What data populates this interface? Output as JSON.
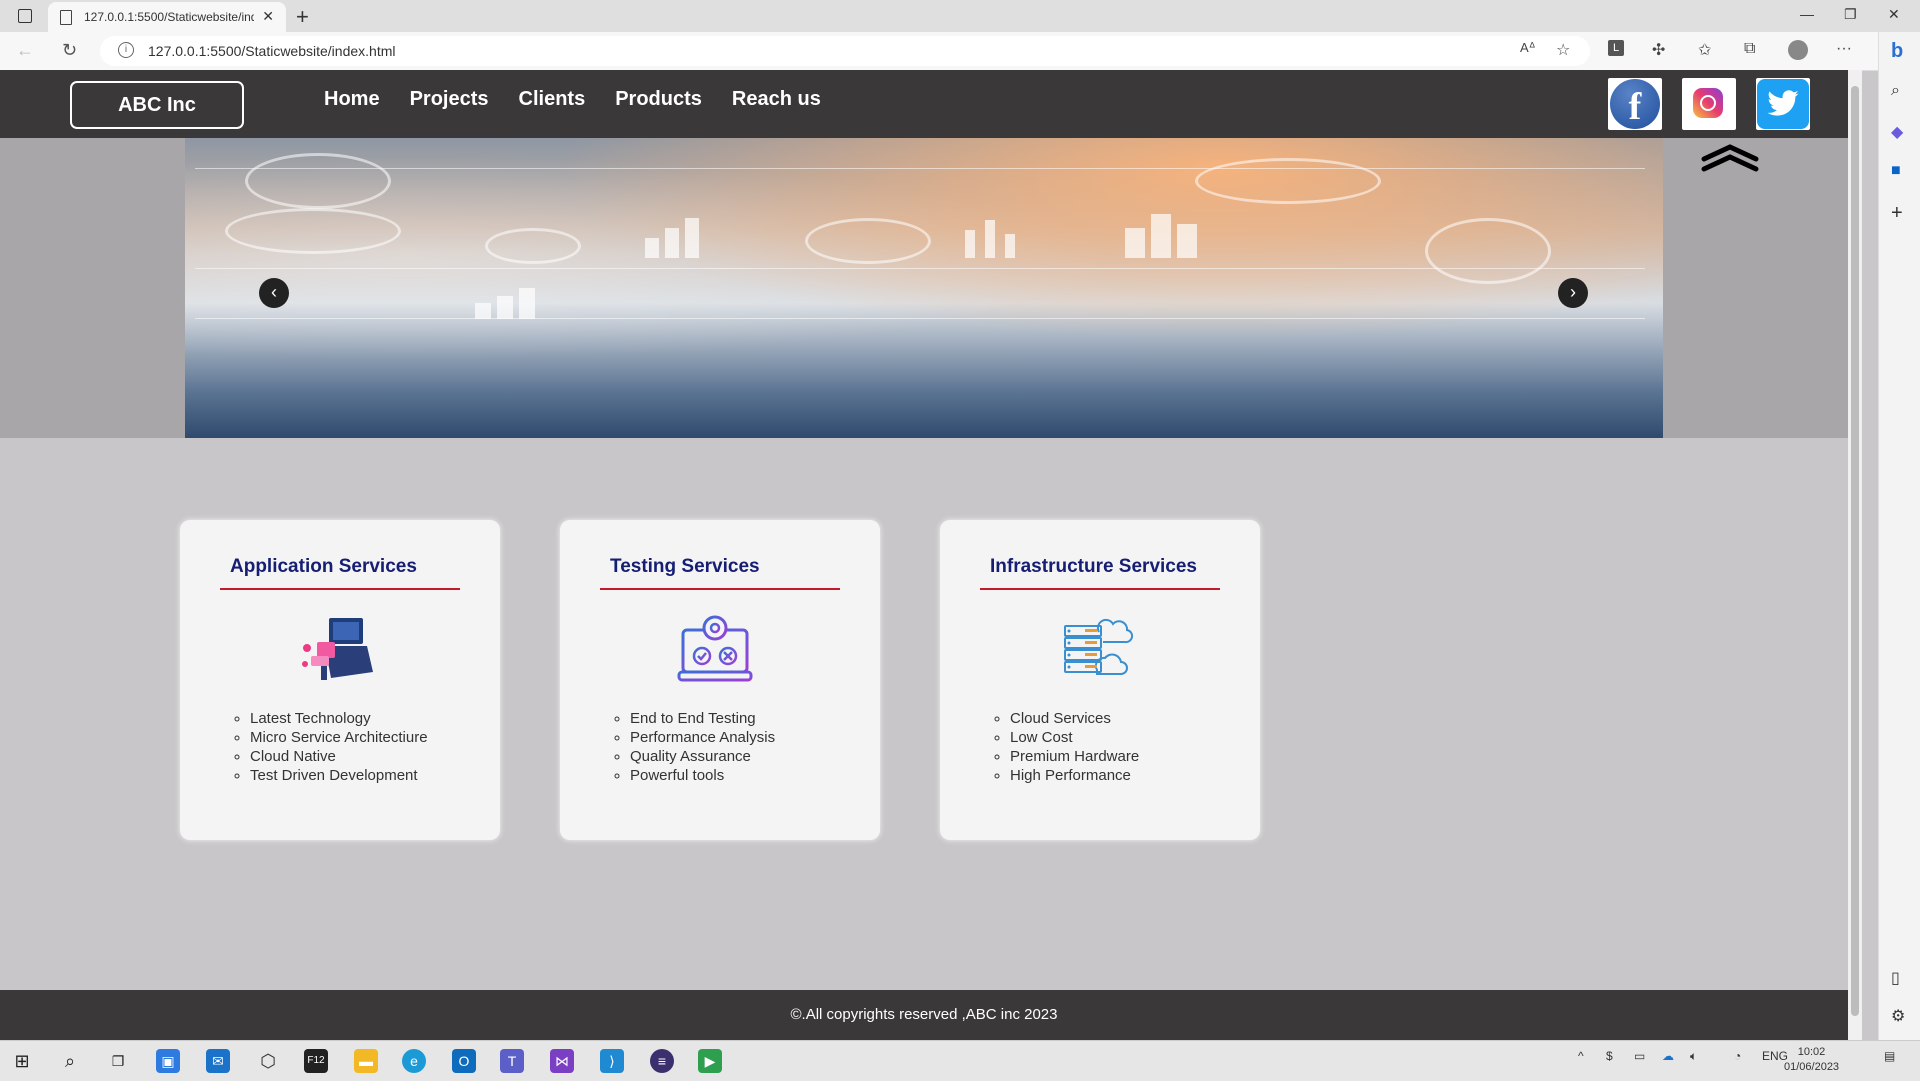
{
  "browser": {
    "tab_title": "127.0.0.1:5500/Staticwebsite/inde",
    "url": "127.0.0.1:5500/Staticwebsite/index.html"
  },
  "site": {
    "logo": "ABC Inc",
    "nav": [
      "Home",
      "Projects",
      "Clients",
      "Products",
      "Reach us"
    ],
    "social": [
      {
        "name": "facebook",
        "glyph": "f"
      },
      {
        "name": "instagram"
      },
      {
        "name": "twitter"
      }
    ],
    "carousel": {
      "prev": "‹",
      "next": "›"
    },
    "cards": [
      {
        "title": "Application Services",
        "icon": "developer-laptop-icon",
        "items": [
          "Latest Technology",
          "Micro Service Architectiure",
          "Cloud Native",
          "Test Driven Development"
        ]
      },
      {
        "title": "Testing Services",
        "icon": "testing-gear-laptop-icon",
        "items": [
          "End to End Testing",
          "Performance Analysis",
          "Quality Assurance",
          "Powerful tools"
        ]
      },
      {
        "title": "Infrastructure Services",
        "icon": "server-cloud-icon",
        "items": [
          "Cloud Services",
          "Low Cost",
          "Premium Hardware",
          "High Performance"
        ]
      }
    ],
    "footer": "©.All copyrights reserved ,ABC inc 2023"
  },
  "taskbar": {
    "lang": "ENG",
    "time": "10:02",
    "date": "01/06/2023"
  },
  "colors": {
    "header": "#3a3839",
    "card_title": "#151e72",
    "card_rule": "#c21a2b",
    "page_bg": "#c8c6c8"
  }
}
